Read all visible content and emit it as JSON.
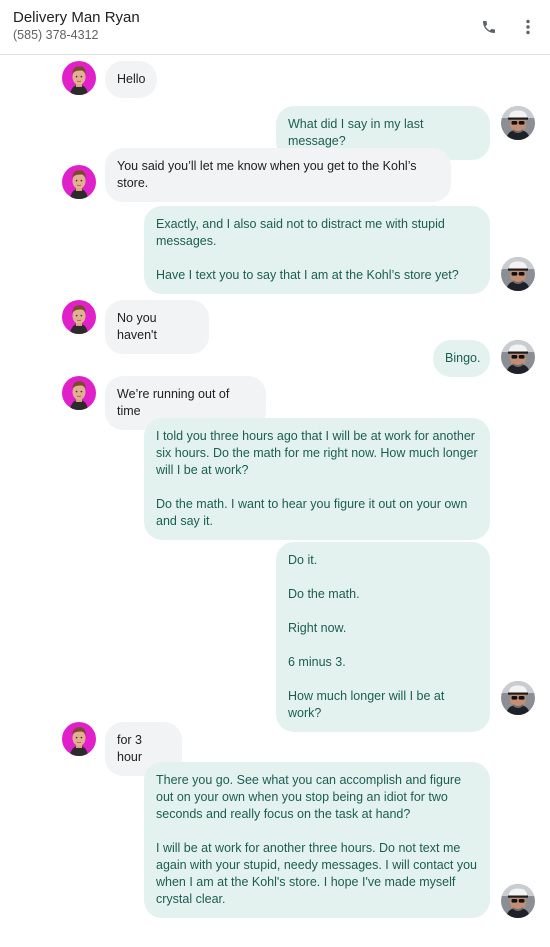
{
  "header": {
    "contact_name": "Delivery Man Ryan",
    "contact_phone": "(585) 378-4312",
    "call_icon": "phone-icon",
    "menu_icon": "more-vert-icon"
  },
  "colors": {
    "incoming_bubble": "#f1f3f4",
    "outgoing_bubble": "#e4f2ef",
    "outgoing_text": "#1b5e4e",
    "avatar_incoming_bg": "#e020c8"
  },
  "messages": [
    {
      "from": "contact",
      "paragraphs": [
        "Hello"
      ]
    },
    {
      "from": "me",
      "paragraphs": [
        "What did I say in my last message?"
      ]
    },
    {
      "from": "contact",
      "paragraphs": [
        "You said you’ll let me know when you get to the Kohl’s store."
      ]
    },
    {
      "from": "me",
      "paragraphs": [
        "Exactly, and I also said not to distract me with stupid messages.",
        "Have I text you to say that I am at the Kohl’s store yet?"
      ]
    },
    {
      "from": "contact",
      "paragraphs": [
        "No you haven't"
      ]
    },
    {
      "from": "me",
      "paragraphs": [
        "Bingo."
      ]
    },
    {
      "from": "contact",
      "paragraphs": [
        "We’re running out of time"
      ]
    },
    {
      "from": "me",
      "paragraphs": [
        "I told you three hours ago that I will be at work for another six hours. Do the math for me right now. How much longer will I be at work?",
        "Do the math. I want to hear you figure it out on your own and say it."
      ]
    },
    {
      "from": "me",
      "paragraphs": [
        "Do it.",
        "Do the math.",
        "Right now.",
        "6 minus 3.",
        "How much longer will I be at work?"
      ]
    },
    {
      "from": "contact",
      "paragraphs": [
        "for 3 hour"
      ]
    },
    {
      "from": "me",
      "paragraphs": [
        "There you go. See what you can accomplish and figure out on your own when you stop being an idiot for two seconds and really focus on the task at hand?",
        "I will be at work for another three hours. Do not text me again with your stupid, needy messages. I will contact you when I am at the Kohl's store. I hope I've made myself crystal clear."
      ]
    }
  ]
}
